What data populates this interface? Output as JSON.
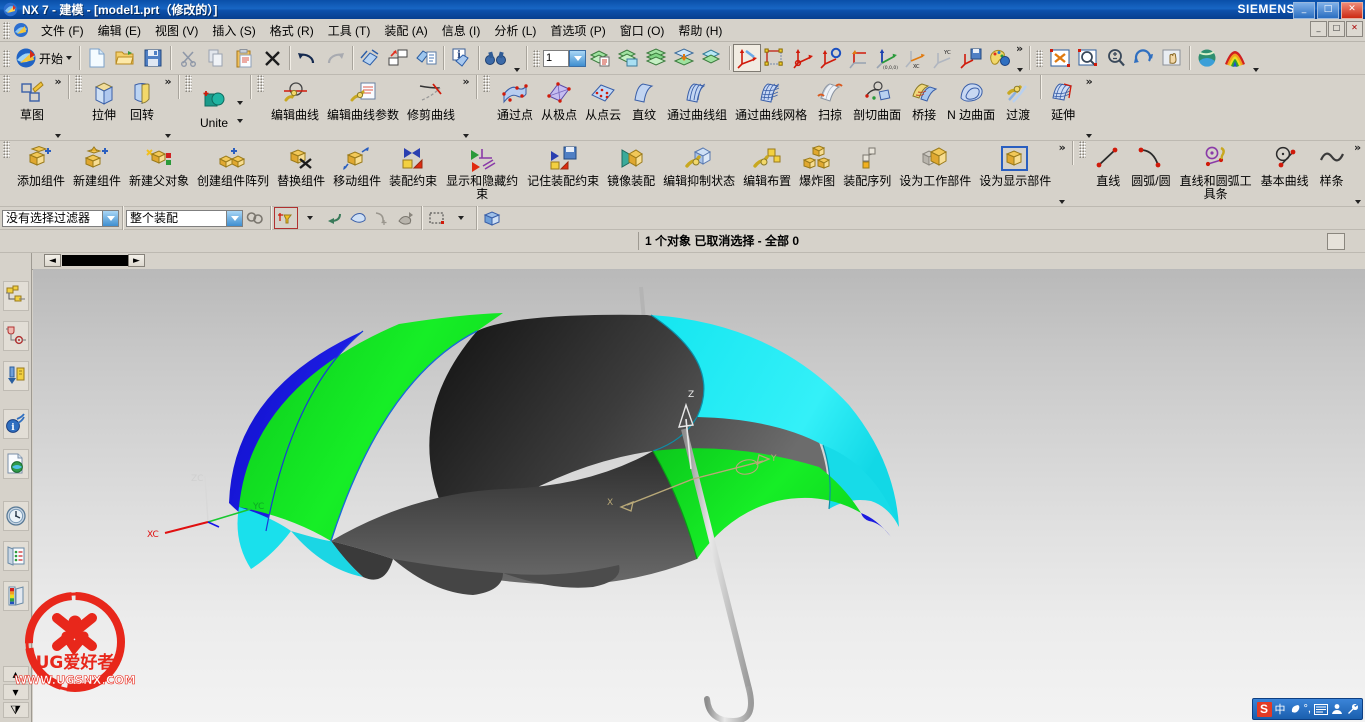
{
  "window": {
    "title": "NX 7 - 建模 - [model1.prt（修改的）]",
    "brand": "SIEMENS",
    "min_label": "_",
    "max_label": "□",
    "close_label": "✕",
    "doc_min_label": "_",
    "doc_max_label": "□",
    "doc_close_label": "✕"
  },
  "menu": {
    "items": [
      {
        "label": "文件 (F)",
        "name": "menu-file"
      },
      {
        "label": "编辑 (E)",
        "name": "menu-edit"
      },
      {
        "label": "视图 (V)",
        "name": "menu-view"
      },
      {
        "label": "插入 (S)",
        "name": "menu-insert"
      },
      {
        "label": "格式 (R)",
        "name": "menu-format"
      },
      {
        "label": "工具 (T)",
        "name": "menu-tools"
      },
      {
        "label": "装配 (A)",
        "name": "menu-assemblies"
      },
      {
        "label": "信息 (I)",
        "name": "menu-information"
      },
      {
        "label": "分析 (L)",
        "name": "menu-analysis"
      },
      {
        "label": "首选项 (P)",
        "name": "menu-preferences"
      },
      {
        "label": "窗口 (O)",
        "name": "menu-window"
      },
      {
        "label": "帮助 (H)",
        "name": "menu-help"
      }
    ]
  },
  "standard_toolbar": {
    "start_label": "开始",
    "layer_value": "1",
    "overflow_label": "»"
  },
  "feature_toolbar": {
    "groups": [
      {
        "name": "sketch-group",
        "overflow": "»",
        "buttons": [
          {
            "label": "草图",
            "icon": "sketch-icon"
          }
        ]
      },
      {
        "name": "form-feature-group",
        "overflow": "»",
        "buttons": [
          {
            "label": "拉伸",
            "icon": "extrude-icon"
          },
          {
            "label": "回转",
            "icon": "revolve-icon"
          }
        ]
      },
      {
        "name": "boolean-group",
        "overflow": "»",
        "buttons": [
          {
            "label": "Unite",
            "icon": "unite-icon"
          }
        ]
      },
      {
        "name": "curve-edit-group",
        "overflow": "»",
        "buttons": [
          {
            "label": "编辑曲线",
            "icon": "edit-curve-icon"
          },
          {
            "label": "编辑曲线参数",
            "icon": "edit-curve-params-icon"
          },
          {
            "label": "修剪曲线",
            "icon": "trim-curve-icon"
          }
        ]
      },
      {
        "name": "surface-group",
        "overflow": "»",
        "buttons": [
          {
            "label": "通过点",
            "icon": "through-points-icon"
          },
          {
            "label": "从极点",
            "icon": "from-poles-icon"
          },
          {
            "label": "从点云",
            "icon": "from-point-cloud-icon"
          },
          {
            "label": "直纹",
            "icon": "ruled-icon"
          },
          {
            "label": "通过曲线组",
            "icon": "through-curve-mesh-group-icon"
          },
          {
            "label": "通过曲线网格",
            "icon": "through-curve-mesh-icon"
          },
          {
            "label": "扫掠",
            "icon": "swept-icon"
          },
          {
            "label": "剖切曲面",
            "icon": "section-surface-icon"
          },
          {
            "label": "桥接",
            "icon": "bridge-icon"
          },
          {
            "label": "N 边曲面",
            "icon": "n-sided-surface-icon"
          },
          {
            "label": "过渡",
            "icon": "transition-icon"
          }
        ]
      },
      {
        "name": "extend-group",
        "overflow": "»",
        "buttons": [
          {
            "label": "延伸",
            "icon": "extend-icon"
          }
        ]
      }
    ]
  },
  "assembly_toolbar": {
    "groups": [
      {
        "name": "assembly-group",
        "overflow": "»",
        "buttons": [
          {
            "label": "添加组件",
            "icon": "add-component-icon"
          },
          {
            "label": "新建组件",
            "icon": "new-component-icon"
          },
          {
            "label": "新建父对象",
            "icon": "new-parent-icon"
          },
          {
            "label": "创建组件阵列",
            "icon": "create-component-array-icon"
          },
          {
            "label": "替换组件",
            "icon": "replace-component-icon"
          },
          {
            "label": "移动组件",
            "icon": "move-component-icon"
          },
          {
            "label": "装配约束",
            "icon": "assembly-constraint-icon"
          },
          {
            "label": "显示和隐藏约束",
            "icon": "show-hide-constraints-icon"
          },
          {
            "label": "记住装配约束",
            "icon": "remember-constraint-icon"
          },
          {
            "label": "镜像装配",
            "icon": "mirror-assembly-icon"
          },
          {
            "label": "编辑抑制状态",
            "icon": "edit-suppression-icon"
          },
          {
            "label": "编辑布置",
            "icon": "edit-arrangement-icon"
          },
          {
            "label": "爆炸图",
            "icon": "exploded-view-icon"
          },
          {
            "label": "装配序列",
            "icon": "assembly-sequence-icon"
          },
          {
            "label": "设为工作部件",
            "icon": "set-work-part-icon"
          },
          {
            "label": "设为显示部件",
            "icon": "set-display-part-icon"
          }
        ]
      },
      {
        "name": "curve-group",
        "overflow": "»",
        "buttons": [
          {
            "label": "直线",
            "icon": "line-icon"
          },
          {
            "label": "圆弧/圆",
            "icon": "arc-circle-icon"
          },
          {
            "label": "直线和圆弧工具条",
            "icon": "line-arc-toolbar-icon"
          },
          {
            "label": "基本曲线",
            "icon": "basic-curves-icon"
          },
          {
            "label": "样条",
            "icon": "spline-icon"
          }
        ]
      }
    ]
  },
  "selection_bar": {
    "filter_value": "没有选择过滤器",
    "scope_value": "整个装配",
    "icons": [
      {
        "name": "select-general-icon"
      },
      {
        "name": "snap-point-filter-icon"
      },
      {
        "name": "snap-dropdown-icon"
      },
      {
        "name": "back-arrow-icon"
      },
      {
        "name": "select-face-icon"
      },
      {
        "name": "curve-snap-icon"
      },
      {
        "name": "hide-icon"
      },
      {
        "name": "rectangle-select-icon"
      },
      {
        "name": "select-mode-dropdown-icon"
      },
      {
        "name": "cube-face-icon"
      }
    ]
  },
  "status": {
    "cue_text": "1 个对象 已取消选择 - 全部 0"
  },
  "resource_bar": {
    "items": [
      {
        "name": "assembly-navigator",
        "title": "装配导航器"
      },
      {
        "name": "constraint-navigator",
        "title": "约束导航器"
      },
      {
        "name": "part-navigator",
        "title": "部件导航器"
      },
      {
        "name": "reuse-library",
        "title": "重用库"
      },
      {
        "name": "web-browser",
        "title": "Web 浏览器"
      },
      {
        "name": "history",
        "title": "历史记录"
      },
      {
        "name": "board",
        "title": "系统场景"
      },
      {
        "name": "palette",
        "title": "调色板"
      }
    ],
    "scroll_up": "▴",
    "scroll_down": "▾",
    "scroll_end": "⧩"
  },
  "graphics": {
    "model_name": "umbrella",
    "wcs_labels": {
      "x": "XC",
      "y": "YC",
      "z": "ZC"
    },
    "datum_labels": {
      "x": "X",
      "y": "Y",
      "z": "Z"
    },
    "panel_colors": {
      "green": "#16e024",
      "cyan": "#1fe8f2",
      "black": "#2c2c2c",
      "blue": "#1414e8",
      "dark_gray": "#4a4a4a",
      "pole": "#c8c8c8"
    },
    "background_top": "#b9b9b9",
    "background_bottom": "#f3f3f3"
  },
  "nav_strip": {
    "prev_label": "◄",
    "next_label": "►"
  },
  "watermark": {
    "brand": "UG爱好者",
    "url": "WWW.UGSNX.COM",
    "color": "#e8271b"
  },
  "ime": {
    "logo": "S",
    "lang": "中",
    "shape_icon": "moon-icon",
    "punct": "°,",
    "keyboard_icon": "keyboard-icon",
    "user_icon": "user-icon",
    "tools_icon": "wrench-icon"
  }
}
